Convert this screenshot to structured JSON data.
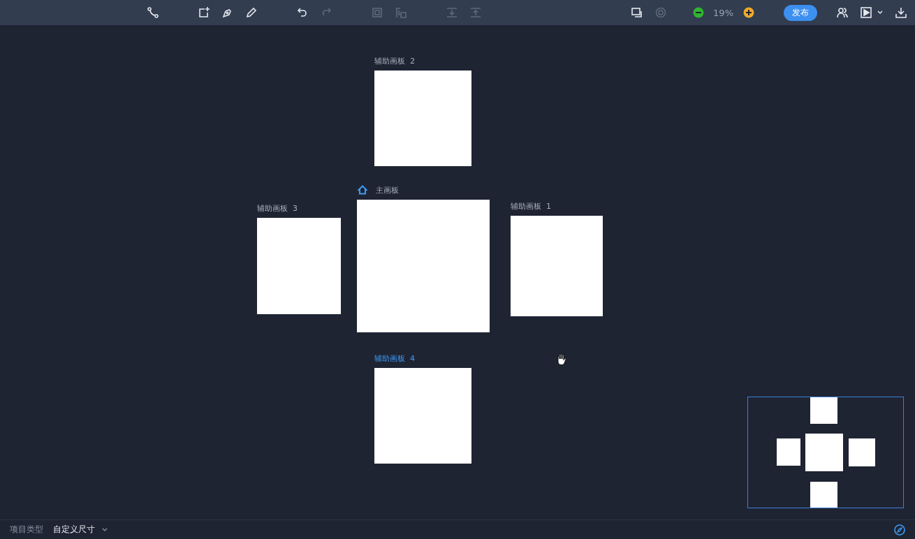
{
  "toolbar": {
    "groups": [
      [
        {
          "kind": "connect",
          "disabled": false
        }
      ],
      [
        {
          "kind": "add-artboard",
          "disabled": false
        },
        {
          "kind": "pen",
          "disabled": false
        },
        {
          "kind": "pencil",
          "disabled": false
        }
      ],
      [
        {
          "kind": "undo",
          "disabled": false
        },
        {
          "kind": "redo",
          "disabled": true
        }
      ],
      [
        {
          "kind": "frame",
          "disabled": true
        },
        {
          "kind": "frame-split",
          "disabled": true
        }
      ],
      [
        {
          "kind": "align-down",
          "disabled": true
        },
        {
          "kind": "align-up",
          "disabled": true
        }
      ]
    ],
    "view_tools": [
      {
        "kind": "window",
        "disabled": false
      },
      {
        "kind": "target",
        "disabled": true
      }
    ],
    "zoom": "19%",
    "publish": "发布"
  },
  "artboards": [
    {
      "label": "辅助画板  2",
      "kind": "aux",
      "selected": false
    },
    {
      "label": "主画板",
      "kind": "main",
      "selected": false
    },
    {
      "label": "辅助画板  3",
      "kind": "aux",
      "selected": false
    },
    {
      "label": "辅助画板  1",
      "kind": "aux",
      "selected": false
    },
    {
      "label": "辅助画板  4",
      "kind": "aux",
      "selected": true
    }
  ],
  "status_bar": {
    "label": "项目类型",
    "value": "自定义尺寸"
  }
}
